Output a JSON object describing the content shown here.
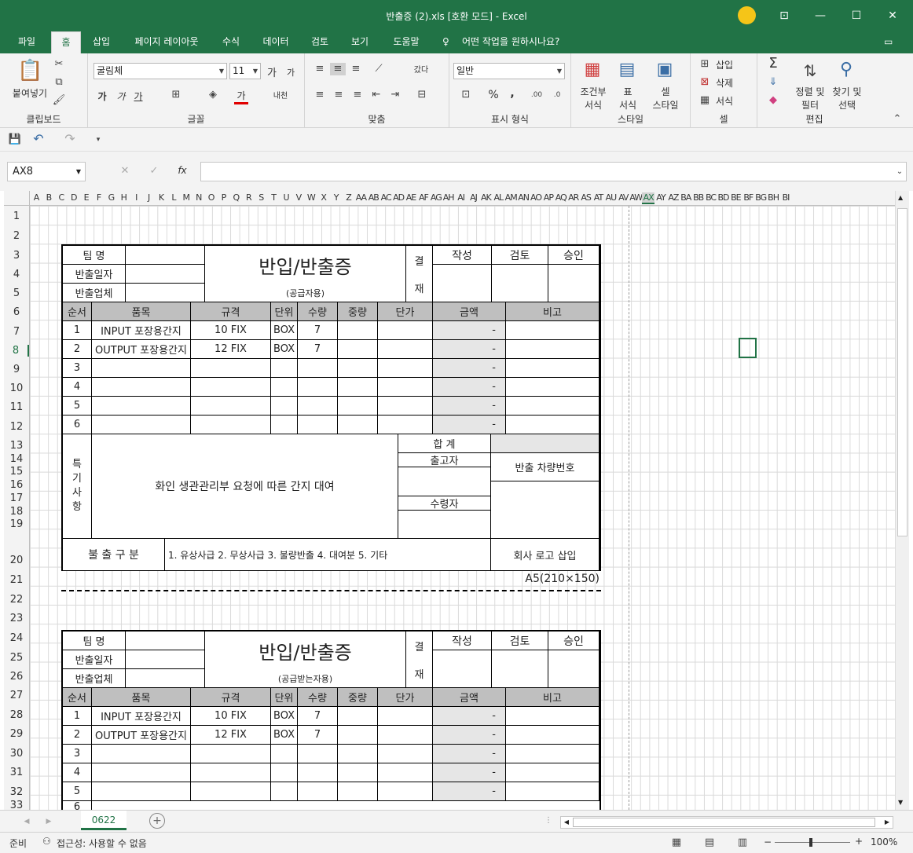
{
  "window": {
    "title": "반출증 (2).xls  [호환 모드]  -  Excel",
    "minimize": "—",
    "restore": "⧉",
    "maximize": "☐",
    "close": "✕"
  },
  "menu": {
    "items": [
      "파일",
      "홈",
      "삽입",
      "페이지 레이아웃",
      "수식",
      "데이터",
      "검토",
      "보기",
      "도움말"
    ],
    "active": "홈",
    "tell_me": "어떤 작업을 원하시나요?"
  },
  "ribbon": {
    "clipboard": {
      "paste": "붙여넣기",
      "label": "클립보드"
    },
    "font": {
      "name": "굴림체",
      "size": "11",
      "grow": "가",
      "shrink": "가",
      "bold": "가",
      "italic": "가",
      "underline": "가",
      "color_a": "가",
      "phonetic": "내천",
      "label": "글꼴"
    },
    "align": {
      "wrap": "갔다",
      "label": "맞춤"
    },
    "number": {
      "format": "일반",
      "percent": "%",
      "comma": ",",
      "label": "표시 형식"
    },
    "styles": {
      "cond": "조건부\n서식",
      "table": "표\n서식",
      "cell": "셀\n스타일",
      "label": "스타일"
    },
    "cells": {
      "insert": "삽입",
      "delete": "삭제",
      "format": "서식",
      "label": "셀"
    },
    "editing": {
      "sum": "Σ",
      "sort": "정렬 및\n필터",
      "find": "찾기 및\n선택",
      "label": "편집"
    }
  },
  "formula": {
    "namebox": "AX8",
    "fx": "fx",
    "value": ""
  },
  "grid": {
    "columns": [
      "A",
      "B",
      "C",
      "D",
      "E",
      "F",
      "G",
      "H",
      "I",
      "J",
      "K",
      "L",
      "M",
      "N",
      "O",
      "P",
      "Q",
      "R",
      "S",
      "T",
      "U",
      "V",
      "W",
      "X",
      "Y",
      "Z",
      "AA",
      "AB",
      "AC",
      "AD",
      "AE",
      "AF",
      "AG",
      "AH",
      "AI",
      "AJ",
      "AK",
      "AL",
      "AM",
      "AN",
      "AO",
      "AP",
      "AQ",
      "AR",
      "AS",
      "AT",
      "AU",
      "AV",
      "AW",
      "AX",
      "AY",
      "AZ",
      "BA",
      "BB",
      "BC",
      "BD",
      "BE",
      "BF",
      "BG",
      "BH",
      "BI"
    ],
    "rows": [
      "1",
      "2",
      "3",
      "4",
      "5",
      "6",
      "7",
      "8",
      "9",
      "10",
      "11",
      "12",
      "13",
      "14",
      "15",
      "16",
      "17",
      "18",
      "19",
      "20",
      "21",
      "22",
      "23",
      "24",
      "25",
      "26",
      "27",
      "28",
      "29",
      "30",
      "31",
      "32",
      "33"
    ],
    "selected_col": "AX",
    "selected_row": "8"
  },
  "form": {
    "team": "팀      명",
    "date": "반출일자",
    "vendor": "반출업체",
    "title": "반입/반출증",
    "sub_top": "(공급자용)",
    "sub_bottom": "(공급받는자용)",
    "approval": "결",
    "approval2": "재",
    "write": "작성",
    "review": "검토",
    "approve": "승인",
    "headers": [
      "순서",
      "품목",
      "규격",
      "단위",
      "수량",
      "중량",
      "단가",
      "금액",
      "비고"
    ],
    "rows": [
      {
        "no": "1",
        "item": "INPUT 포장용간지",
        "spec": "10 FIX",
        "unit": "BOX",
        "qty": "7",
        "amt": "-"
      },
      {
        "no": "2",
        "item": "OUTPUT 포장용간지",
        "spec": "12 FIX",
        "unit": "BOX",
        "qty": "7",
        "amt": "-"
      },
      {
        "no": "3",
        "item": "",
        "spec": "",
        "unit": "",
        "qty": "",
        "amt": "-"
      },
      {
        "no": "4",
        "item": "",
        "spec": "",
        "unit": "",
        "qty": "",
        "amt": "-"
      },
      {
        "no": "5",
        "item": "",
        "spec": "",
        "unit": "",
        "qty": "",
        "amt": "-"
      },
      {
        "no": "6",
        "item": "",
        "spec": "",
        "unit": "",
        "qty": "",
        "amt": "-"
      }
    ],
    "remarks_label": "특\n기\n사\n항",
    "remarks": "화인 생관관리부 요청에 따른 간지 대여",
    "total": "합  계",
    "shipper": "출고자",
    "receiver": "수령자",
    "vehicle": "반출 차량번호",
    "type_label": "불 출 구 분",
    "type_options": "1. 유상사급  2. 무상사급  3. 불량반출  4. 대여분  5. 기타",
    "logo": "회사 로고 삽입",
    "paper": "A5(210×150)"
  },
  "tabs": {
    "sheet": "0622",
    "add": "+"
  },
  "status": {
    "ready": "준비",
    "accessibility": "접근성: 사용할 수 없음",
    "zoom": "100%"
  }
}
